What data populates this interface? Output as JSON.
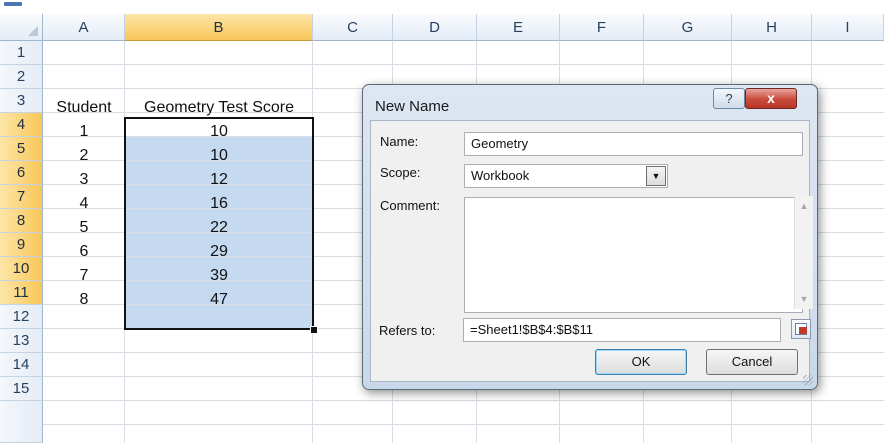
{
  "columns": [
    "A",
    "B",
    "C",
    "D",
    "E",
    "F",
    "G",
    "H",
    "I"
  ],
  "rows": [
    "1",
    "2",
    "3",
    "4",
    "5",
    "6",
    "7",
    "8",
    "9",
    "10",
    "11",
    "12",
    "13",
    "14",
    "15"
  ],
  "selected_column": "B",
  "selected_rows": [
    "4",
    "5",
    "6",
    "7",
    "8",
    "9",
    "10",
    "11"
  ],
  "headers": {
    "student": "Student",
    "score": "Geometry Test Score"
  },
  "data_rows": [
    {
      "student": "1",
      "score": "10"
    },
    {
      "student": "2",
      "score": "10"
    },
    {
      "student": "3",
      "score": "12"
    },
    {
      "student": "4",
      "score": "16"
    },
    {
      "student": "5",
      "score": "22"
    },
    {
      "student": "6",
      "score": "29"
    },
    {
      "student": "7",
      "score": "39"
    },
    {
      "student": "8",
      "score": "47"
    }
  ],
  "dialog": {
    "title": "New Name",
    "help_label": "?",
    "close_label": "x",
    "name_label": "Name:",
    "name_value": "Geometry",
    "scope_label": "Scope:",
    "scope_value": "Workbook",
    "comment_label": "Comment:",
    "comment_value": "",
    "refers_label": "Refers to:",
    "refers_value": "=Sheet1!$B$4:$B$11",
    "ok_label": "OK",
    "cancel_label": "Cancel"
  },
  "icons": {
    "dropdown": "chevron-down-icon",
    "range_picker": "collapse-dialog-icon",
    "scroll_up": "scroll-up-icon",
    "scroll_down": "scroll-down-icon"
  },
  "colors": {
    "selection_fill": "#c5d9f1",
    "header_highlight": "#f8c65a",
    "close_button": "#c94a3b"
  }
}
